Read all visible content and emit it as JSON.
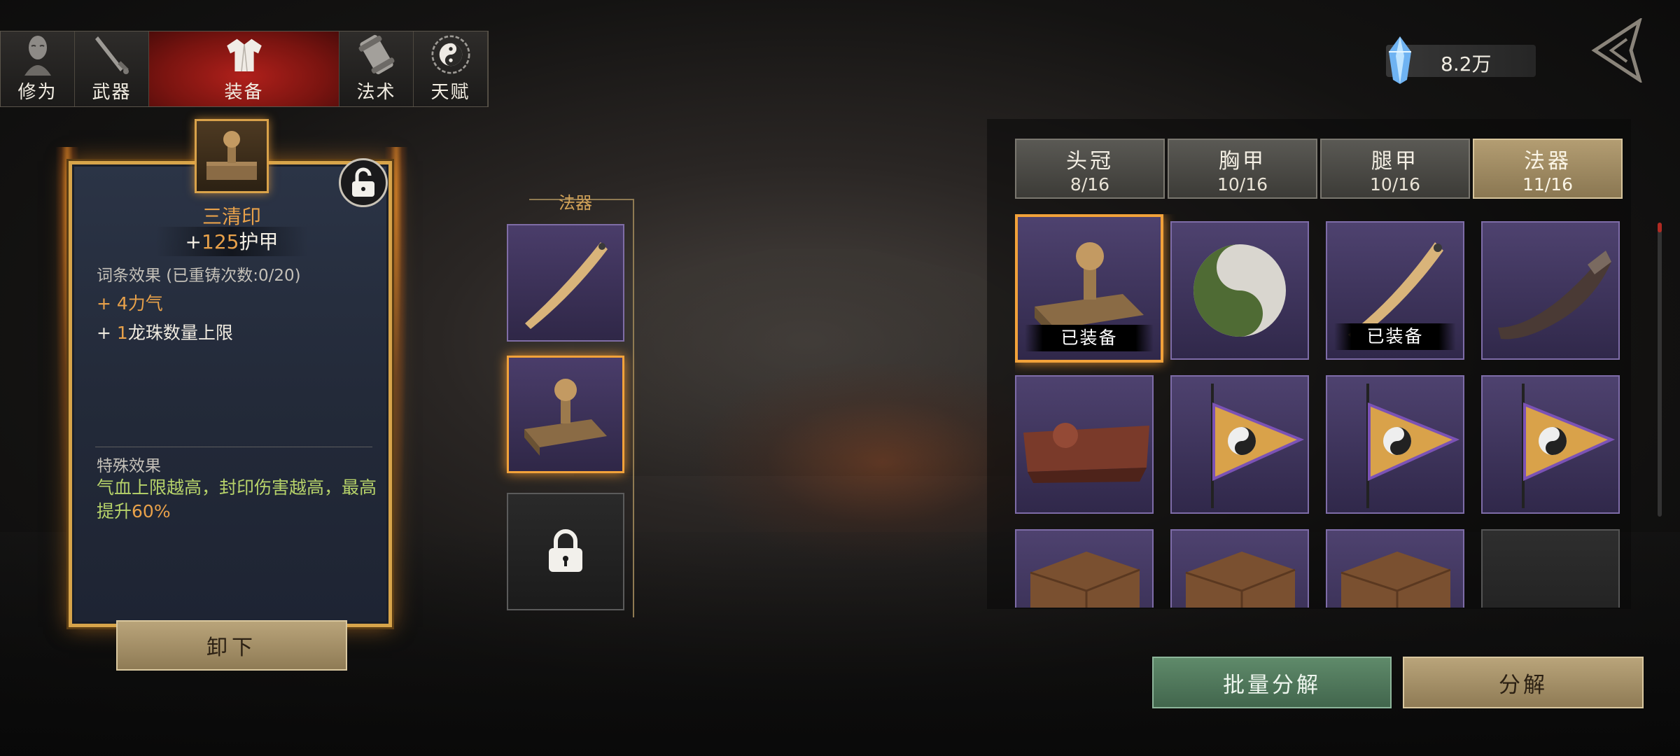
{
  "nav": {
    "tabs": [
      {
        "label": "修为",
        "icon": "cultivation-head-icon"
      },
      {
        "label": "武器",
        "icon": "sword-icon"
      },
      {
        "label": "装备",
        "icon": "robe-icon",
        "active": true
      },
      {
        "label": "法术",
        "icon": "scroll-icon"
      },
      {
        "label": "天赋",
        "icon": "taiji-icon"
      }
    ]
  },
  "currency": {
    "amount": "8.2万",
    "icon": "crystal-gem-icon"
  },
  "detail": {
    "name": "三清印",
    "armor_prefix": "+",
    "armor_value": "125",
    "armor_label": "护甲",
    "stat_header": "词条效果  (已重铸次数:0/20)",
    "stat1": "+ 4力气",
    "stat2_prefix": "+ ",
    "stat2_value": "1",
    "stat2_label": "龙珠数量上限",
    "special_header": "特殊效果",
    "special_text": "气血上限越高，封印伤害越高，最高提升",
    "special_pct": "60%",
    "unequip_label": "卸下"
  },
  "slot_column": {
    "title": "法器"
  },
  "categories": [
    {
      "name": "头冠",
      "count": "8/16"
    },
    {
      "name": "胸甲",
      "count": "10/16"
    },
    {
      "name": "腿甲",
      "count": "10/16"
    },
    {
      "name": "法器",
      "count": "11/16",
      "active": true
    }
  ],
  "equipped_label": "已装备",
  "actions": {
    "batch": "批量分解",
    "dismantle": "分解"
  },
  "colors": {
    "accent_gold": "#e8a14a",
    "special_green": "#b7d36a",
    "active_red": "#b0201b",
    "selected_orange": "#f2a23a"
  }
}
